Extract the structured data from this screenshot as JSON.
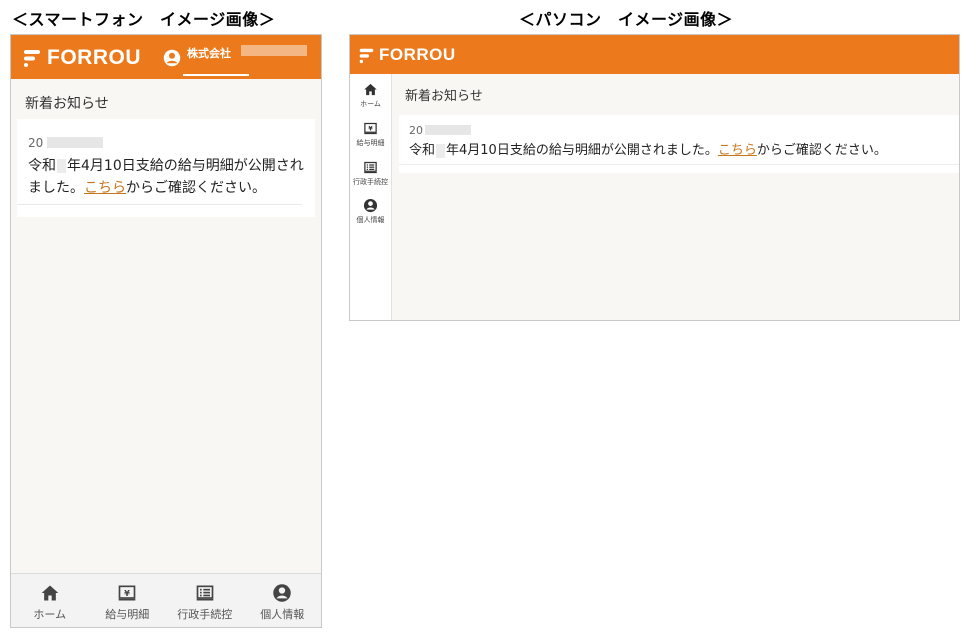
{
  "captions": {
    "phone": "＜スマートフォン　イメージ画像＞",
    "pc": "＜パソコン　イメージ画像＞"
  },
  "app": {
    "brand": "FORROU"
  },
  "colors": {
    "header": "#ec7a1c",
    "link": "#c8761e",
    "background": "#f8f7f4"
  },
  "phone": {
    "company": "株式会社",
    "news_title": "新着お知らせ",
    "notice": {
      "date_prefix": "20",
      "message_pre": "令和",
      "message_main": "年4月10日支給の給与明細が公開されました。",
      "link_text": "こちら",
      "message_post": "からご確認ください。"
    },
    "tabs": [
      {
        "label": "ホーム",
        "icon": "home-icon"
      },
      {
        "label": "給与明細",
        "icon": "yen-icon"
      },
      {
        "label": "行政手続控",
        "icon": "document-list-icon"
      },
      {
        "label": "個人情報",
        "icon": "user-icon"
      }
    ]
  },
  "pc": {
    "news_title": "新着お知らせ",
    "notice": {
      "date_prefix": "20",
      "message_pre": "令和",
      "message_main": "年4月10日支給の給与明細が公開されました。",
      "link_text": "こちら",
      "message_post": "からご確認ください。"
    },
    "side_nav": [
      {
        "label": "ホーム",
        "icon": "home-icon"
      },
      {
        "label": "給与明細",
        "icon": "yen-icon"
      },
      {
        "label": "行政手続控",
        "icon": "document-list-icon"
      },
      {
        "label": "個人情報",
        "icon": "user-icon"
      }
    ]
  }
}
